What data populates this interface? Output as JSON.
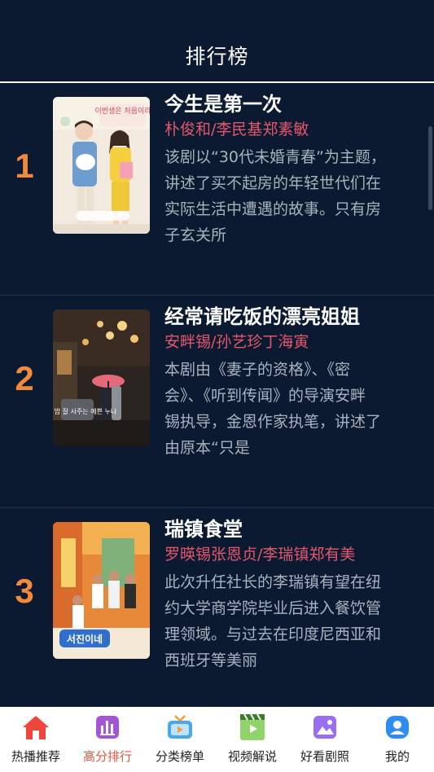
{
  "header": {
    "title": "排行榜"
  },
  "items": [
    {
      "rank": "1",
      "title": "今生是第一次",
      "cast": "朴俊和/李民基郑素敏",
      "desc": [
        "该剧以“30代未婚青春”为主题，",
        "讲述了买不起房的年轻世代们在",
        "实际生活中遭遇的故事。只有房",
        "子玄关所"
      ],
      "poster_text": "이번생은 처음이라"
    },
    {
      "rank": "2",
      "title": "经常请吃饭的漂亮姐姐",
      "cast": "安畔锡/孙艺珍丁海寅",
      "desc": [
        "本剧由《妻子的资格》、《密",
        "会》、《听到传闻》的导演安畔",
        "锡执导，金恩作家执笔，讲述了",
        "由原本“只是"
      ],
      "poster_text": "밥 잘 사주는 예쁜 누나"
    },
    {
      "rank": "3",
      "title": "瑞镇食堂",
      "cast": "罗暎锡张恩贞/李瑞镇郑有美",
      "desc": [
        "此次升任社长的李瑞镇有望在纽",
        "约大学商学院毕业后进入餐饮管",
        "理领域。与过去在印度尼西亚和",
        "西班牙等美丽"
      ],
      "poster_text": "서진이네"
    }
  ],
  "tabbar": [
    {
      "label": "热播推荐",
      "icon": "home-icon",
      "active": false
    },
    {
      "label": "高分排行",
      "icon": "bar-chart-icon",
      "active": true
    },
    {
      "label": "分类榜单",
      "icon": "tv-icon",
      "active": false
    },
    {
      "label": "视频解说",
      "icon": "film-play-icon",
      "active": false
    },
    {
      "label": "好看剧照",
      "icon": "photo-icon",
      "active": false
    },
    {
      "label": "我的",
      "icon": "user-icon",
      "active": false
    }
  ],
  "colors": {
    "background": "#0b1a30",
    "rank": "#f08a3c",
    "cast": "#e4566b",
    "active_tab": "#e3533b"
  }
}
